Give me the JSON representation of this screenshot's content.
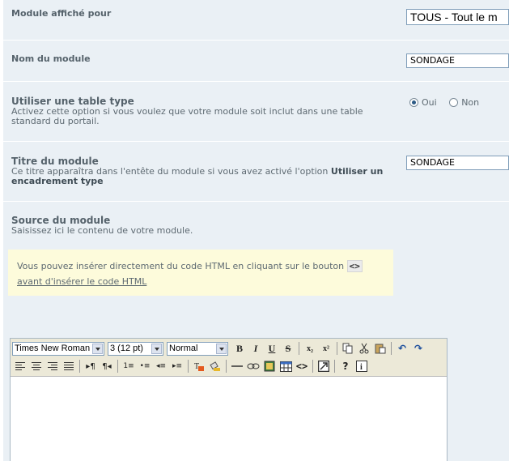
{
  "module_shown_for": {
    "label": "Module affiché pour",
    "value": "TOUS - Tout le m"
  },
  "module_name": {
    "label": "Nom du module",
    "value": "SONDAGE"
  },
  "use_table": {
    "label": "Utiliser une table type",
    "desc": "Activez cette option si vous voulez que votre module soit inclut dans une table standard du portail.",
    "options": [
      "Oui",
      "Non"
    ],
    "selected": "Oui"
  },
  "module_title": {
    "label": "Titre du module",
    "desc_start": "Ce titre apparaîtra dans l'entête du module si vous avez activé l'option ",
    "desc_bold": "Utiliser un encadrement type",
    "value": "SONDAGE"
  },
  "module_source": {
    "label": "Source du module",
    "desc": "Saisissez ici le contenu de votre module."
  },
  "notice": {
    "line1": "Vous pouvez insérer directement du code HTML en cliquant sur le bouton",
    "code_glyph": "<>",
    "line2": "avant d'insérer le code HTML"
  },
  "editor": {
    "font_family": "Times New Roman",
    "font_size": "3 (12 pt)",
    "format": "Normal",
    "buttons_row1": [
      "B",
      "I",
      "U",
      "S",
      "x₂",
      "x²"
    ],
    "icons_row1": [
      "copy-icon",
      "cut-icon",
      "paste-icon",
      "undo-icon",
      "redo-icon"
    ],
    "icons_row2": [
      "align-left-icon",
      "align-center-icon",
      "align-right-icon",
      "justify-icon",
      "ltr-icon",
      "rtl-icon",
      "ordered-list-icon",
      "unordered-list-icon",
      "outdent-icon",
      "indent-icon",
      "text-color-icon",
      "bg-color-icon",
      "hr-icon",
      "link-icon",
      "image-icon",
      "table-icon",
      "html-code-icon",
      "fullscreen-icon",
      "help-icon",
      "about-icon"
    ]
  }
}
